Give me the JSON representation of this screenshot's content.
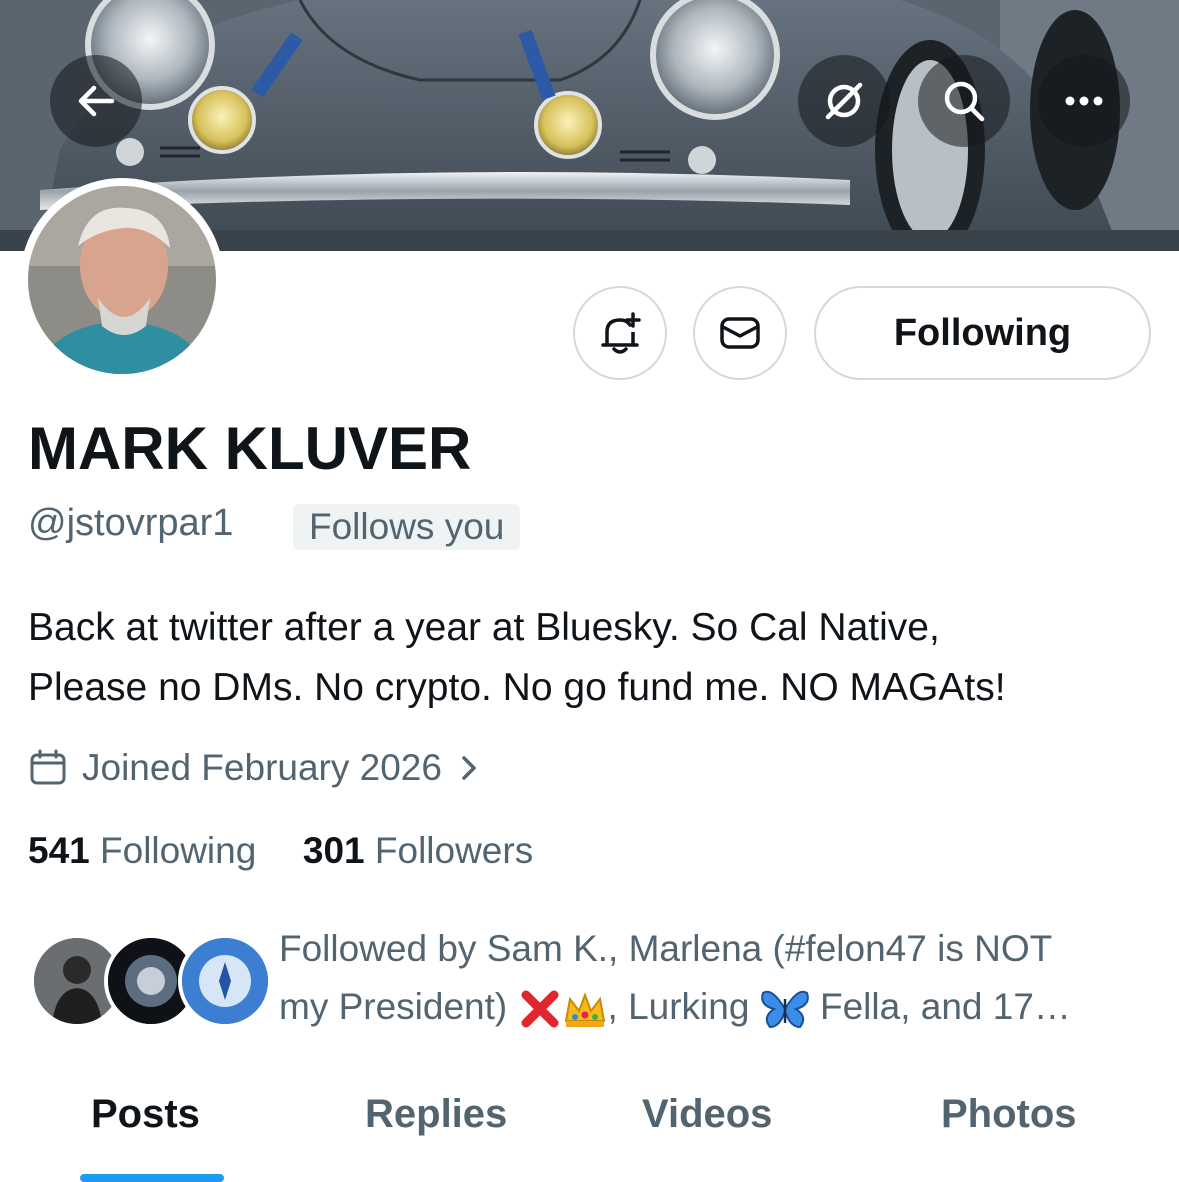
{
  "header": {
    "back_icon": "arrow-left-icon",
    "grok_icon": "grok-icon",
    "search_icon": "search-icon",
    "more_icon": "more-horizontal-icon"
  },
  "profile": {
    "name": "MARK KLUVER",
    "handle": "@jstovrpar1",
    "follows_you": "Follows you",
    "bio_line1": "Back at twitter after a year at Bluesky. So Cal Native,",
    "bio_line2": "Please no DMs. No crypto. No go fund me. NO MAGAts!",
    "joined": "Joined February 2026",
    "following_count": "541",
    "following_label": "Following",
    "followers_count": "301",
    "followers_label": "Followers"
  },
  "actions": {
    "notify_icon": "bell-plus-icon",
    "message_icon": "envelope-icon",
    "following_button": "Following"
  },
  "followed_by": {
    "line1": "Followed by Sam K., Marlena (#felon47 is NOT",
    "line2_a": "my President)",
    "line2_b": ", Lurking",
    "line2_c": "Fella, and 17…"
  },
  "tabs": [
    {
      "label": "Posts",
      "active": true
    },
    {
      "label": "Replies",
      "active": false
    },
    {
      "label": "Videos",
      "active": false
    },
    {
      "label": "Photos",
      "active": false
    }
  ],
  "colors": {
    "accent": "#1d9bf0",
    "text_primary": "#0f1419",
    "text_secondary": "#536471",
    "border": "#cfd9de"
  }
}
